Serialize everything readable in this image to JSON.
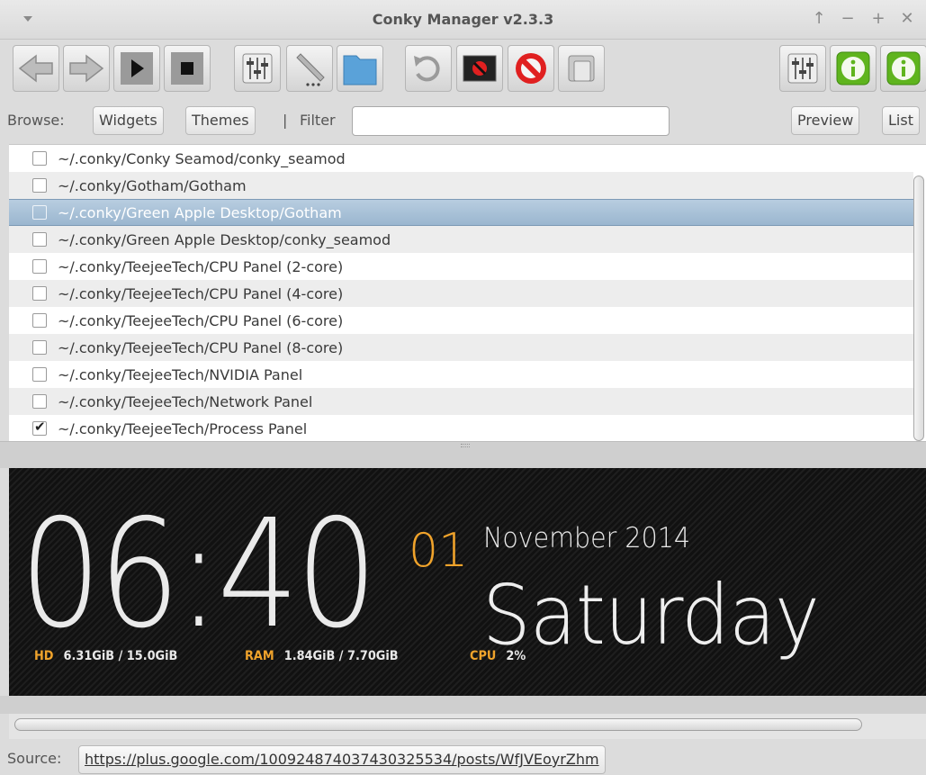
{
  "window": {
    "title": "Conky Manager v2.3.3",
    "controls": {
      "up": "↑",
      "minimize": "−",
      "maximize": "+",
      "close": "✕"
    }
  },
  "toolbar": {
    "buttons": [
      {
        "name": "back-button",
        "icon": "arrow-left-icon"
      },
      {
        "name": "forward-button",
        "icon": "arrow-right-icon"
      },
      {
        "name": "start-button",
        "icon": "play-icon"
      },
      {
        "name": "stop-button",
        "icon": "stop-icon"
      },
      {
        "name": "settings-button",
        "icon": "sliders-icon"
      },
      {
        "name": "edit-button",
        "icon": "pencil-icon"
      },
      {
        "name": "open-folder-button",
        "icon": "folder-icon"
      },
      {
        "name": "refresh-button",
        "icon": "reload-icon"
      },
      {
        "name": "kill-all-button",
        "icon": "stop-screen-icon"
      },
      {
        "name": "disable-button",
        "icon": "no-entry-icon"
      },
      {
        "name": "hide-button",
        "icon": "window-stack-icon"
      },
      {
        "name": "app-settings-button",
        "icon": "sliders-icon"
      },
      {
        "name": "donate-button",
        "icon": "info-icon"
      },
      {
        "name": "about-button",
        "icon": "info-icon"
      }
    ],
    "accent_green": "#5fb41e",
    "accent_red": "#e02020"
  },
  "filterbar": {
    "browse_label": "Browse:",
    "widgets_label": "Widgets",
    "themes_label": "Themes",
    "separator": "|",
    "filter_label": "Filter",
    "filter_value": "",
    "preview_label": "Preview",
    "list_label": "List"
  },
  "list": {
    "items": [
      {
        "path": "~/.conky/Conky Seamod/conky_seamod",
        "checked": false,
        "selected": false
      },
      {
        "path": "~/.conky/Gotham/Gotham",
        "checked": false,
        "selected": false
      },
      {
        "path": "~/.conky/Green Apple Desktop/Gotham",
        "checked": false,
        "selected": true
      },
      {
        "path": "~/.conky/Green Apple Desktop/conky_seamod",
        "checked": false,
        "selected": false
      },
      {
        "path": "~/.conky/TeejeeTech/CPU Panel (2-core)",
        "checked": false,
        "selected": false
      },
      {
        "path": "~/.conky/TeejeeTech/CPU Panel (4-core)",
        "checked": false,
        "selected": false
      },
      {
        "path": "~/.conky/TeejeeTech/CPU Panel (6-core)",
        "checked": false,
        "selected": false
      },
      {
        "path": "~/.conky/TeejeeTech/CPU Panel (8-core)",
        "checked": false,
        "selected": false
      },
      {
        "path": "~/.conky/TeejeeTech/NVIDIA Panel",
        "checked": false,
        "selected": false
      },
      {
        "path": "~/.conky/TeejeeTech/Network Panel",
        "checked": false,
        "selected": false
      },
      {
        "path": "~/.conky/TeejeeTech/Process Panel",
        "checked": true,
        "selected": false
      }
    ],
    "selection_color": "#9ab6cf"
  },
  "preview": {
    "time": "06:40",
    "day_number": "01",
    "month_year": "November 2014",
    "weekday": "Saturday",
    "stats": [
      {
        "key": "HD",
        "value": "6.31GiB / 15.0GiB"
      },
      {
        "key": "RAM",
        "value": "1.84GiB / 7.70GiB"
      },
      {
        "key": "CPU",
        "value": "2%"
      }
    ],
    "accent_color": "#f0a32b"
  },
  "status": {
    "source_label": "Source:",
    "source_url": "https://plus.google.com/100924874037430325534/posts/WfJVEoyrZhm"
  }
}
